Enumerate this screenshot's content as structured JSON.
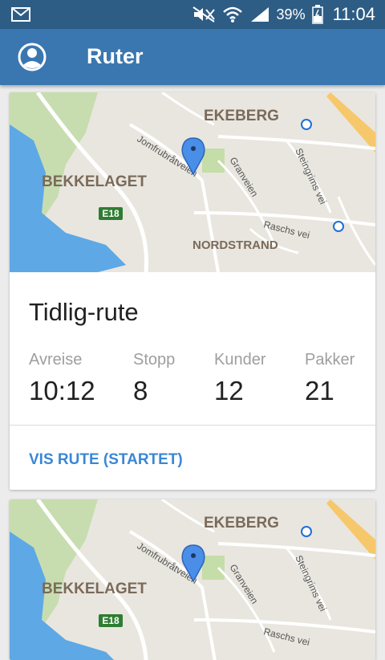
{
  "status_bar": {
    "battery": "39%",
    "time": "11:04",
    "icons": [
      "mail-icon",
      "mute-icon",
      "wifi-icon",
      "signal-icon",
      "battery-icon"
    ]
  },
  "app_bar": {
    "title": "Ruter",
    "icon": "account-icon"
  },
  "map": {
    "labels": {
      "ekeberg": "EKEBERG",
      "bekkelaget": "BEKKELAGET",
      "nordstrand": "NORDSTRAND",
      "e18": "E18",
      "jomfrubraatveien": "Jomfrubråtveien",
      "granveien": "Granveien",
      "steingrims_vei": "Steingrims vei",
      "raschs_vei": "Raschs vei"
    }
  },
  "routes": [
    {
      "title": "Tidlig-rute",
      "stats": [
        {
          "label": "Avreise",
          "value": "10:12"
        },
        {
          "label": "Stopp",
          "value": "8"
        },
        {
          "label": "Kunder",
          "value": "12"
        },
        {
          "label": "Pakker",
          "value": "21"
        }
      ],
      "action": "VIS RUTE (STARTET)"
    }
  ],
  "colors": {
    "status_bar": "#2d5d85",
    "app_bar": "#3a77b0",
    "action": "#3a87d6",
    "water": "#5ea8e6",
    "park": "#c5dda8"
  }
}
